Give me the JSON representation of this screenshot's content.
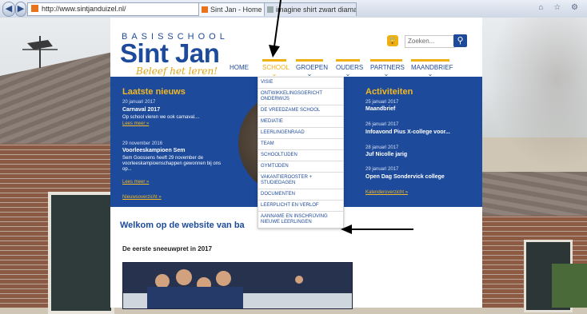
{
  "browser": {
    "address": "http://www.sintjanduizel.nl/",
    "address_controls": "⌕ → ↻",
    "back_icon": "back-arrow-icon",
    "forward_icon": "forward-arrow-icon",
    "tabs": [
      {
        "label": "Sint Jan - Home",
        "close": "×"
      },
      {
        "label": "imagine shirt zwart diamant re...",
        "close": ""
      }
    ],
    "window_controls": "⌂ ☆ ⚙"
  },
  "site": {
    "logo_top": "BASISSCHOOL",
    "logo_name": "Sint Jan",
    "logo_tagline": "Beleef het leren!",
    "search_placeholder": "Zoeken...",
    "nav": [
      {
        "label": "HOME"
      },
      {
        "label": "SCHOOL"
      },
      {
        "label": "GROEPEN"
      },
      {
        "label": "OUDERS"
      },
      {
        "label": "PARTNERS"
      },
      {
        "label": "MAANDBRIEF"
      }
    ],
    "chevron": "⌄"
  },
  "news": {
    "heading": "Laatste nieuws",
    "items": [
      {
        "date": "20 januari 2017",
        "title": "Carnaval 2017",
        "body": "Op school vieren we ook carnaval....",
        "more": "Lees meer »"
      },
      {
        "date": "29 november 2016",
        "title": "Voorleeskampioen Sem",
        "body": "Sem Goossens heeft 29 november de voorleeskampioenschappen gewonnen bij ons op...",
        "more": "Lees meer »"
      }
    ],
    "overview": "Nieuwsoverzicht »"
  },
  "activities": {
    "heading": "Activiteiten",
    "items": [
      {
        "date": "25 januari 2017",
        "title": "Maandbrief"
      },
      {
        "date": "26 januari 2017",
        "title": "Infoavond Pius X-college voor..."
      },
      {
        "date": "28 januari 2017",
        "title": "Juf Nicolle jarig"
      },
      {
        "date": "29 januari 2017",
        "title": "Open Dag Sondervick college"
      }
    ],
    "overview": "Kalenderoverzicht »"
  },
  "dropdown": [
    "VISIE",
    "ONTWIKKELINGSGERICHT ONDERWIJS",
    "DE VREEDZAME SCHOOL",
    "MEDIATIE",
    "LEERLINGENRAAD",
    "TEAM",
    "SCHOOLTIJDEN",
    "GYMTIJDEN",
    "VAKANTIEROOSTER + STUDIEDAGEN",
    "DOCUMENTEN",
    "LEERPLICHT EN VERLOF",
    "AANNAME EN INSCHRIJVING NIEUWE LEERLINGEN"
  ],
  "content": {
    "welcome": "Welkom op de website van ba",
    "subheading": "De eerste sneeuwpret in 2017"
  },
  "colors": {
    "brand_blue": "#1d4a9a",
    "accent_yellow": "#f0b010"
  }
}
